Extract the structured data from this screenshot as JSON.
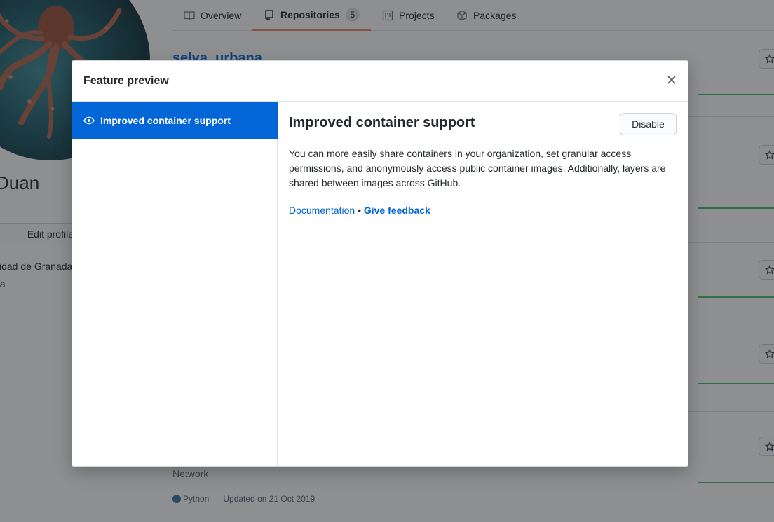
{
  "profile": {
    "name_fragment": "Duan",
    "edit_button": "Edit profile",
    "details": [
      "sidad de Granada",
      "da"
    ]
  },
  "tabs": [
    {
      "label": "Overview",
      "icon": "book-icon"
    },
    {
      "label": "Repositories",
      "icon": "repo-icon",
      "count": "5",
      "selected": true
    },
    {
      "label": "Projects",
      "icon": "project-icon"
    },
    {
      "label": "Packages",
      "icon": "package-icon"
    }
  ],
  "repos": {
    "first_title": "selva_urbana",
    "last_description": "Network",
    "last_language": "Python",
    "last_updated": "Updated on 21 Oct 2019"
  },
  "modal": {
    "title": "Feature preview",
    "close_icon": "x-icon",
    "features": [
      {
        "label": "Improved container support",
        "icon": "eye-icon",
        "selected": true
      }
    ],
    "content": {
      "title": "Improved container support",
      "disable_button": "Disable",
      "description": "You can more easily share containers in your organization, set granular access permissions, and anonymously access public container images. Additionally, layers are shared between images across GitHub.",
      "documentation_link": "Documentation",
      "separator": "•",
      "feedback_link": "Give feedback"
    }
  },
  "colors": {
    "accent": "#0366d6",
    "tab_underline": "#f9826c",
    "activity_green": "#40c463",
    "python": "#3572A5"
  }
}
